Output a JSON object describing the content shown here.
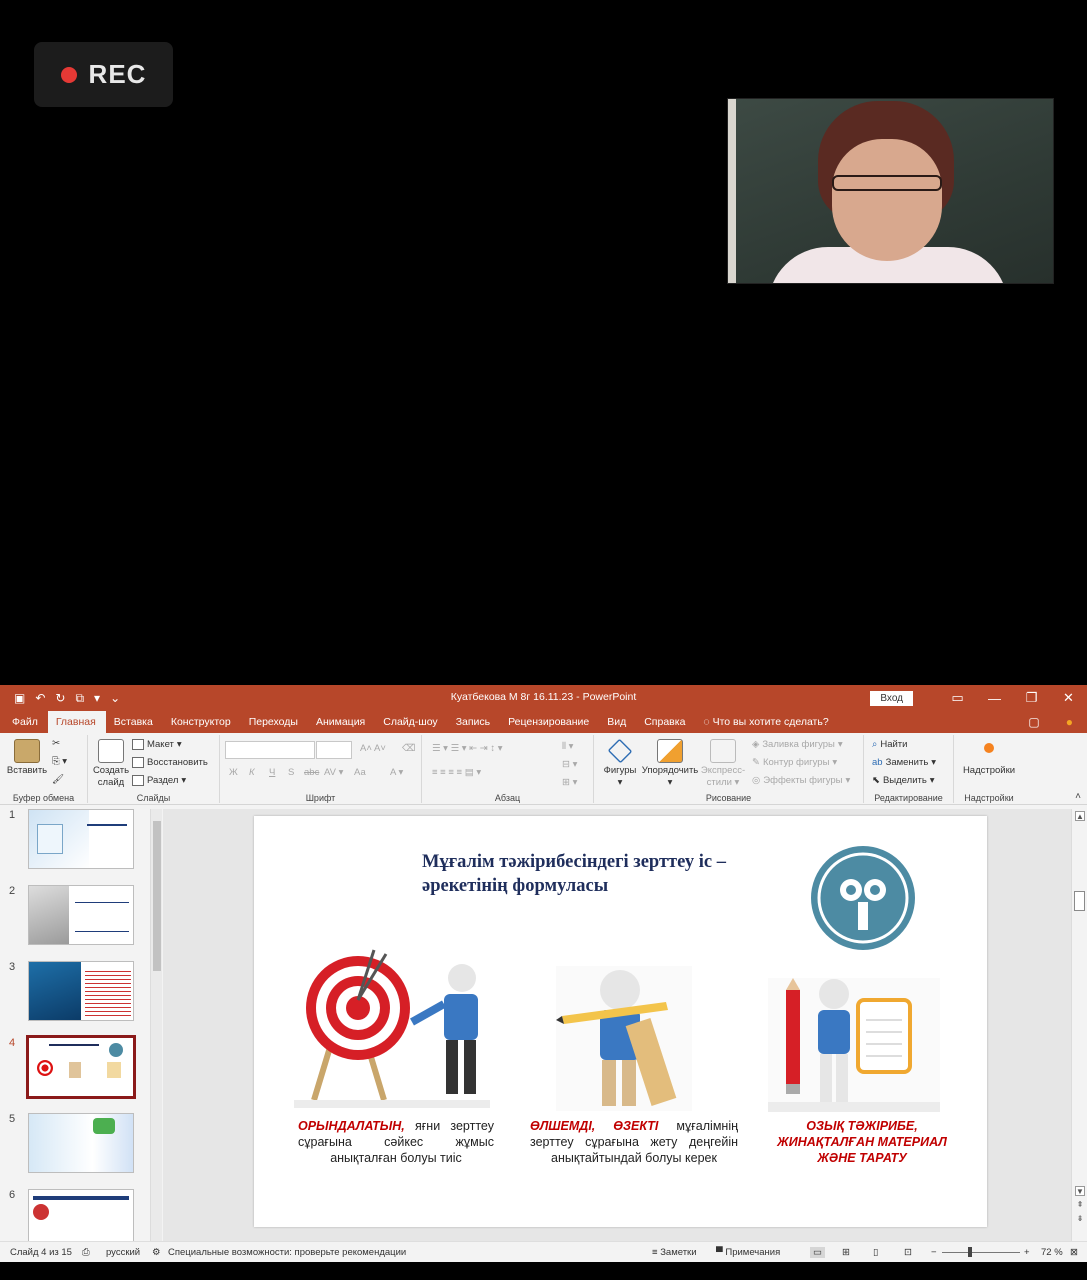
{
  "recording": {
    "label": "REC"
  },
  "window": {
    "title": "Куатбекова М 8г 16.11.23  -  PowerPoint",
    "login_label": "Вход"
  },
  "tabs": [
    {
      "label": "Файл"
    },
    {
      "label": "Главная"
    },
    {
      "label": "Вставка"
    },
    {
      "label": "Конструктор"
    },
    {
      "label": "Переходы"
    },
    {
      "label": "Анимация"
    },
    {
      "label": "Слайд-шоу"
    },
    {
      "label": "Запись"
    },
    {
      "label": "Рецензирование"
    },
    {
      "label": "Вид"
    },
    {
      "label": "Справка"
    },
    {
      "label": "Что вы хотите сделать?"
    }
  ],
  "ribbon": {
    "clipboard": {
      "paste": "Вставить",
      "group": "Буфер обмена"
    },
    "slides": {
      "create": "Создать",
      "create2": "слайд",
      "layout": "Макет",
      "reset": "Восстановить",
      "section": "Раздел",
      "group": "Слайды"
    },
    "font": {
      "group": "Шрифт",
      "bold": "Ж",
      "italic": "К",
      "underline": "Ч",
      "strike": "S",
      "abc": "abc",
      "aa": "Аа"
    },
    "paragraph": {
      "group": "Абзац"
    },
    "drawing": {
      "shapes": "Фигуры",
      "arrange": "Упорядочить",
      "express": "Экспресс-",
      "express2": "стили",
      "fill": "Заливка фигуры",
      "outline": "Контур фигуры",
      "effects": "Эффекты фигуры",
      "group": "Рисование"
    },
    "editing": {
      "find": "Найти",
      "replace": "Заменить",
      "select": "Выделить",
      "group": "Редактирование"
    },
    "addins": {
      "label": "Надстройки",
      "group": "Надстройки"
    }
  },
  "thumbnails": [
    {
      "num": "1"
    },
    {
      "num": "2"
    },
    {
      "num": "3"
    },
    {
      "num": "4",
      "active": true
    },
    {
      "num": "5"
    },
    {
      "num": "6"
    }
  ],
  "slide": {
    "title_line1": "Мұғалім тәжірибесіндегі зерттеу іс –",
    "title_line2": "әрекетінің формуласы",
    "caption1_red": "ОРЫНДАЛАТЫН,",
    "caption1_rest": " яғни зерттеу сұрағына сәйкес жұмыс анықталған болуы тиіс",
    "caption2_red": "ӨЛШЕМДІ, ӨЗЕКТІ",
    "caption2_rest": " мұғалімнің зерттеу сұрағына жету деңгейін анықтайтындай болуы керек",
    "caption3": "ОЗЫҚ ТӘЖІРИБЕ, ЖИНАҚТАЛҒАН МАТЕРИАЛ ЖӘНЕ ТАРАТУ"
  },
  "status": {
    "slide_counter": "Слайд 4 из 15",
    "language": "русский",
    "accessibility": "Специальные возможности: проверьте рекомендации",
    "notes": "Заметки",
    "comments": "Примечания",
    "zoom": "72 %"
  }
}
